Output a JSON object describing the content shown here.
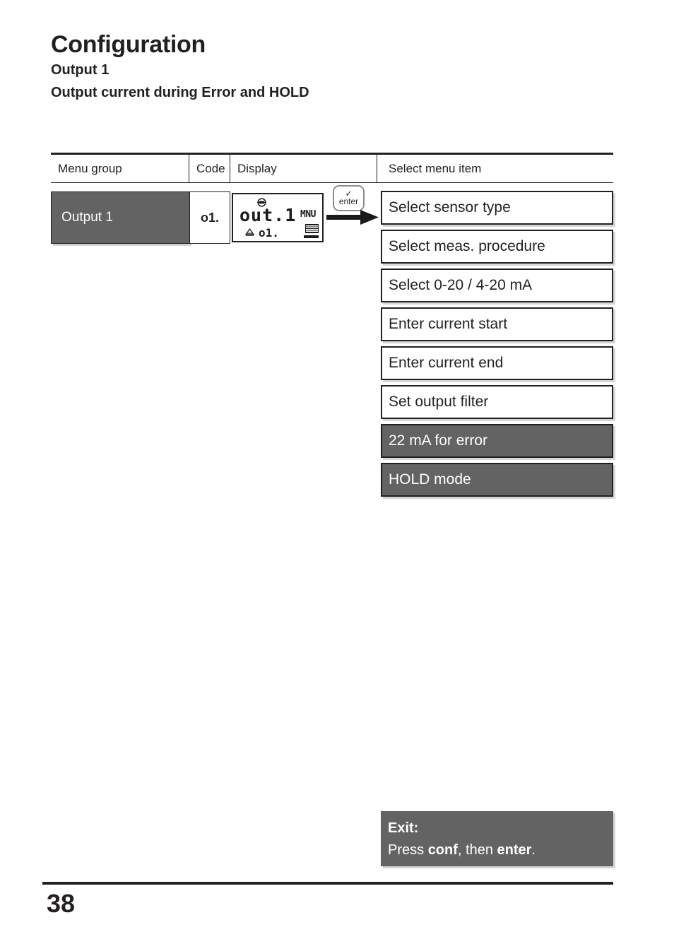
{
  "headings": {
    "title": "Configuration",
    "subtitle1": "Output 1",
    "subtitle2": "Output current during Error and HOLD"
  },
  "table": {
    "headers": {
      "menu_group": "Menu group",
      "code": "Code",
      "display": "Display",
      "select_menu_item": "Select menu item"
    },
    "row": {
      "menu_group": "Output 1",
      "code": "o1."
    }
  },
  "lcd": {
    "main_text": "out.1",
    "mnu_indicator": "MNU",
    "sub_text": "o1.",
    "top_icon": "sensor-circle-icon",
    "warn_icon": "warning-triangle-icon",
    "meas_icon": "meas-display-icon"
  },
  "enter_key": {
    "check_glyph": "✓",
    "label": "enter"
  },
  "menu_items": [
    {
      "label": "Select sensor type",
      "highlighted": false
    },
    {
      "label": "Select meas. procedure",
      "highlighted": false
    },
    {
      "label": "Select 0-20 / 4-20 mA",
      "highlighted": false
    },
    {
      "label": "Enter current start",
      "highlighted": false
    },
    {
      "label": "Enter current end",
      "highlighted": false
    },
    {
      "label": "Set output filter",
      "highlighted": false
    },
    {
      "label": "22 mA for error",
      "highlighted": true
    },
    {
      "label": "HOLD mode",
      "highlighted": true
    }
  ],
  "exit": {
    "title": "Exit:",
    "press": "Press ",
    "key1": "conf",
    "middle": ", then ",
    "key2": "enter",
    "end": "."
  },
  "footer": {
    "page_number": "38"
  },
  "colors": {
    "highlight_gray": "#636363",
    "ink": "#231f20"
  }
}
